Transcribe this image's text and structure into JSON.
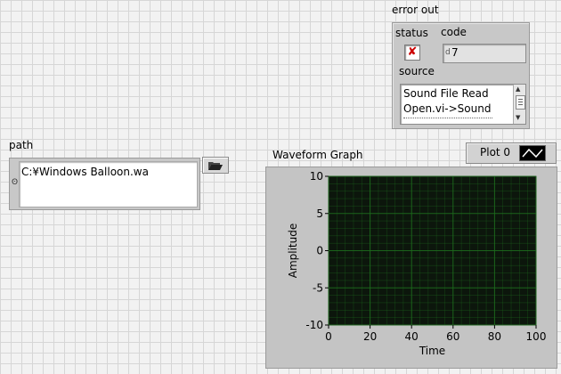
{
  "error_out": {
    "title": "error out",
    "status_label": "status",
    "status_value": "✘",
    "code_label": "code",
    "code_value": "7",
    "code_radix": "d",
    "source_label": "source",
    "source_lines": [
      "Sound File Read",
      "Open.vi->Sound"
    ]
  },
  "path_control": {
    "label": "path",
    "value": "C:¥Windows Balloon.wa",
    "browse_icon": "folder-open-icon"
  },
  "waveform_graph": {
    "label": "Waveform Graph",
    "legend_label": "Plot 0"
  },
  "colors": {
    "plot_area": "#0c160c",
    "grid": "#1d6b1d",
    "status_x": "#cc0000"
  },
  "chart_data": {
    "type": "line",
    "title": "Waveform Graph",
    "xlabel": "Time",
    "ylabel": "Amplitude",
    "xlim": [
      0,
      100
    ],
    "ylim": [
      -10,
      10
    ],
    "x_ticks": [
      "0",
      "20",
      "40",
      "60",
      "80",
      "100"
    ],
    "y_ticks": [
      "10",
      "5",
      "0",
      "-5",
      "-10"
    ],
    "grid": true,
    "series": [
      {
        "name": "Plot 0",
        "values": []
      }
    ]
  }
}
